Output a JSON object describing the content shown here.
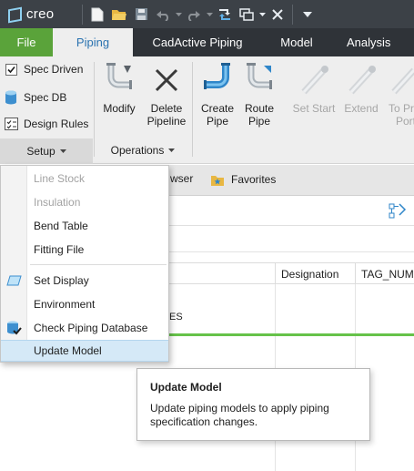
{
  "app": {
    "logo_text": "creo"
  },
  "quick_access": [
    "new-icon",
    "open-icon",
    "save-icon",
    "undo-icon",
    "redo-icon",
    "regenerate-icon",
    "windows-icon",
    "close-icon",
    "customize-icon"
  ],
  "tabs": [
    {
      "label": "File"
    },
    {
      "label": "Piping"
    },
    {
      "label": "CadActive Piping"
    },
    {
      "label": "Model"
    },
    {
      "label": "Analysis"
    }
  ],
  "ribbon": {
    "setup": {
      "items": [
        {
          "label": "Spec Driven",
          "icon": "checkbox-checked-icon"
        },
        {
          "label": "Spec DB",
          "icon": "database-icon"
        },
        {
          "label": "Design Rules",
          "icon": "design-rules-icon"
        }
      ],
      "group_label": "Setup"
    },
    "operations": {
      "buttons": [
        {
          "label1": "Modify",
          "label2": ""
        },
        {
          "label1": "Delete",
          "label2": "Pipeline"
        }
      ],
      "group_label": "Operations"
    },
    "pipe": {
      "buttons": [
        {
          "label1": "Create",
          "label2": "Pipe"
        },
        {
          "label1": "Route",
          "label2": "Pipe"
        },
        {
          "label1": "Set Start",
          "label2": ""
        },
        {
          "label1": "Extend",
          "label2": ""
        },
        {
          "label1": "To Pr",
          "label2": "Port"
        }
      ]
    }
  },
  "strip": {
    "browser_label": "wser",
    "favorites_label": "Favorites"
  },
  "grid": {
    "columns": [
      "Designation",
      "TAG_NUMB"
    ],
    "row_fragment": "ES"
  },
  "menu": {
    "items": [
      {
        "label": "Line Stock",
        "disabled": true
      },
      {
        "label": "Insulation",
        "disabled": true
      },
      {
        "label": "Bend Table",
        "disabled": false
      },
      {
        "label": "Fitting File",
        "disabled": false
      },
      {
        "label": "Set Display",
        "disabled": false
      },
      {
        "label": "Environment",
        "disabled": false
      },
      {
        "label": "Check Piping Database",
        "disabled": false
      },
      {
        "label": "Update Model",
        "disabled": false
      }
    ]
  },
  "tooltip": {
    "title": "Update Model",
    "body": "Update piping models to apply piping specification changes."
  },
  "colors": {
    "file_tab": "#5aa33a",
    "active_tab_text": "#2b73b0",
    "hover_bg": "#d5e9f7",
    "progress_green": "#66c24a"
  }
}
